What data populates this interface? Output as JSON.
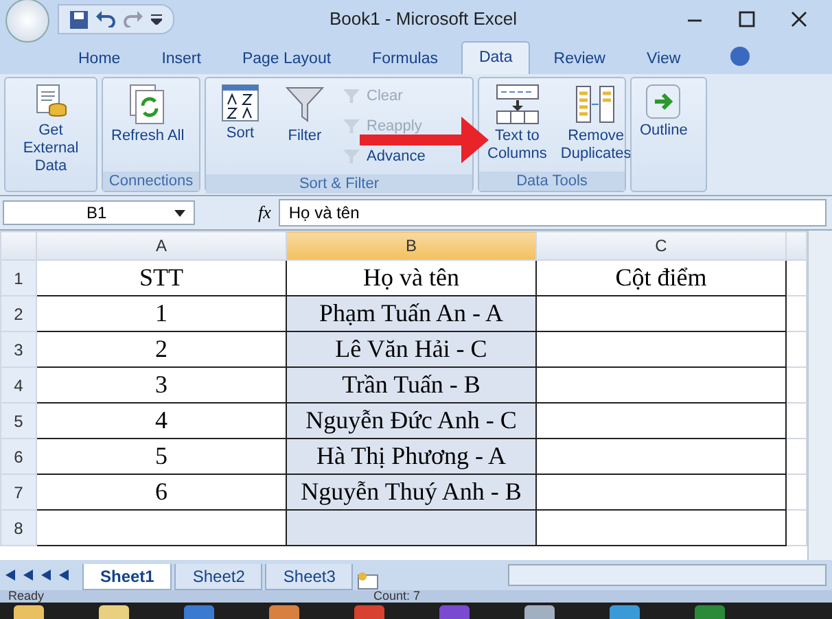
{
  "window": {
    "title": "Book1 - Microsoft Excel"
  },
  "ribbon_tabs": [
    {
      "label": "Home",
      "selected": false
    },
    {
      "label": "Insert",
      "selected": false
    },
    {
      "label": "Page Layout",
      "selected": false
    },
    {
      "label": "Formulas",
      "selected": false
    },
    {
      "label": "Data",
      "selected": true
    },
    {
      "label": "Review",
      "selected": false
    },
    {
      "label": "View",
      "selected": false
    }
  ],
  "ribbon_groups": [
    {
      "buttons": [
        {
          "label": "Get External Data",
          "kind": "large"
        }
      ]
    },
    {
      "label": "Connections",
      "buttons": [
        {
          "label": "Refresh All",
          "kind": "large"
        }
      ]
    },
    {
      "label": "Sort & Filter",
      "buttons": [
        {
          "label": "Sort",
          "kind": "large"
        },
        {
          "label": "Filter",
          "kind": "large"
        },
        {
          "label": "Clear",
          "kind": "small",
          "disabled": true
        },
        {
          "label": "Reapply",
          "kind": "small",
          "disabled": true
        },
        {
          "label": "Advance",
          "kind": "small",
          "disabled": false
        }
      ]
    },
    {
      "label": "Data Tools",
      "buttons": [
        {
          "label": "Text to Columns",
          "kind": "large"
        },
        {
          "label": "Remove Duplicates",
          "kind": "large"
        }
      ]
    },
    {
      "buttons": [
        {
          "label": "Outline",
          "kind": "large"
        }
      ]
    }
  ],
  "formula_bar": {
    "name_box": "B1",
    "function": "fx",
    "value": "Họ và tên"
  },
  "grid": {
    "columns": [
      {
        "label": "A",
        "selected": false
      },
      {
        "label": "B",
        "selected": true
      },
      {
        "label": "C",
        "selected": false
      }
    ],
    "rows": [
      {
        "number": "1",
        "cells": [
          "STT",
          "Họ và tên",
          "Cột điểm"
        ]
      },
      {
        "number": "2",
        "cells": [
          "1",
          "Phạm Tuấn An - A"
        ]
      },
      {
        "number": "3",
        "cells": [
          "2",
          "Lê Văn Hải - C"
        ]
      },
      {
        "number": "4",
        "cells": [
          "3",
          "Trần Tuấn - B"
        ]
      },
      {
        "number": "5",
        "cells": [
          "4",
          "Nguyễn Đức Anh - C"
        ]
      },
      {
        "number": "6",
        "cells": [
          "5",
          "Hà Thị Phương - A"
        ]
      },
      {
        "number": "7",
        "cells": [
          "6",
          "Nguyễn Thuý Anh - B"
        ]
      },
      {
        "number": "8"
      }
    ]
  },
  "sheet_tabs": [
    {
      "label": "Sheet1",
      "selected": true
    },
    {
      "label": "Sheet2",
      "selected": false
    },
    {
      "label": "Sheet3",
      "selected": false
    }
  ],
  "status_bar": {
    "mode": "Ready",
    "count": "Count: 7"
  }
}
